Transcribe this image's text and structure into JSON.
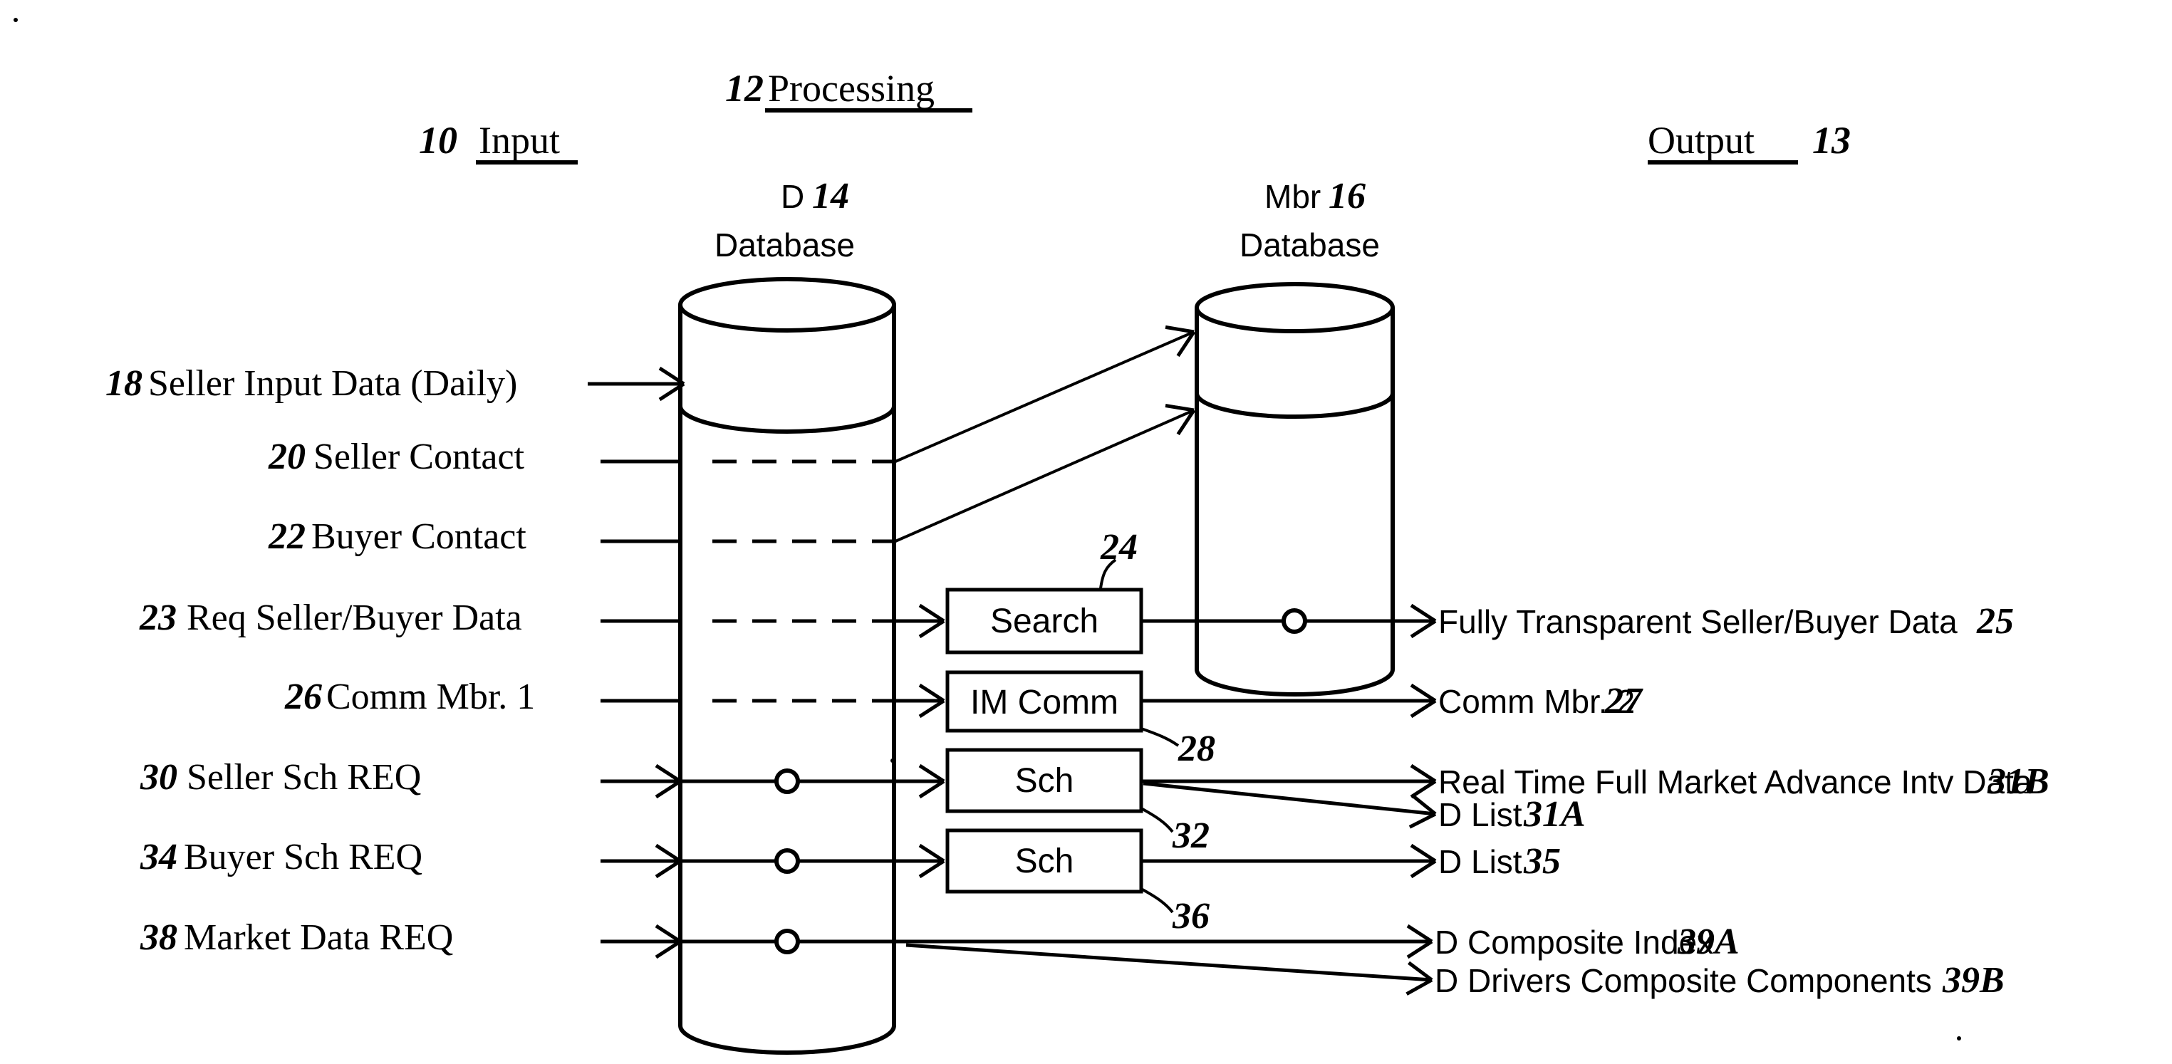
{
  "figure": {
    "title_columns": {
      "input": {
        "ref": "10",
        "label": "Input"
      },
      "processing": {
        "ref": "12",
        "label": "Processing"
      },
      "output": {
        "ref": "13",
        "label": "Output"
      }
    },
    "databases": [
      {
        "name": "d-database",
        "prefix": "D",
        "ref": "14",
        "sub": "Database"
      },
      {
        "name": "mbr-database",
        "prefix": "Mbr",
        "ref": "16",
        "sub": "Database"
      }
    ],
    "inputs": [
      {
        "ref": "18",
        "label": "Seller Input Data (Daily)"
      },
      {
        "ref": "20",
        "label": "Seller Contact"
      },
      {
        "ref": "22",
        "label": "Buyer Contact"
      },
      {
        "ref": "23",
        "label": "Req Seller/Buyer Data"
      },
      {
        "ref": "26",
        "label": "Comm Mbr. 1"
      },
      {
        "ref": "30",
        "label": "Seller Sch REQ"
      },
      {
        "ref": "34",
        "label": "Buyer Sch REQ"
      },
      {
        "ref": "38",
        "label": "Market Data REQ"
      }
    ],
    "process_boxes": [
      {
        "label": "Search",
        "ref": "24"
      },
      {
        "label": "IM Comm",
        "ref": "28"
      },
      {
        "label": "Sch",
        "ref": "32"
      },
      {
        "label": "Sch",
        "ref": "36"
      }
    ],
    "outputs": [
      {
        "label": "Fully Transparent Seller/Buyer Data",
        "ref": "25"
      },
      {
        "label": "Comm Mbr. 2",
        "ref": "27"
      },
      {
        "label": "Real Time Full Market Advance Intv Data",
        "ref": "31B"
      },
      {
        "label": "D List",
        "ref": "31A"
      },
      {
        "label": "D List",
        "ref": "35"
      },
      {
        "label": "D Composite Index",
        "ref": "39A"
      },
      {
        "label": "D Drivers Composite Components",
        "ref": "39B"
      }
    ],
    "colors": {
      "ink": "#000000",
      "paper": "#ffffff"
    }
  }
}
